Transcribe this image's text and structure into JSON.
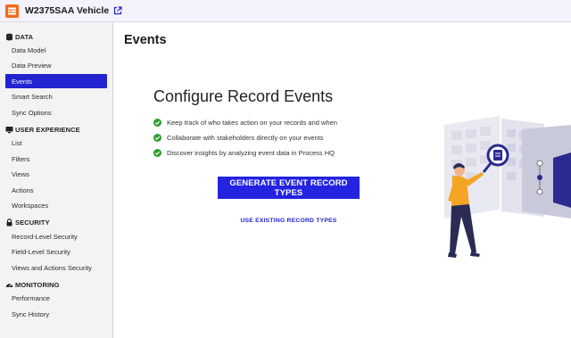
{
  "header": {
    "app_title": "W2375SAA Vehicle",
    "logo_icon": "record-type-icon",
    "open_external_icon": "open-external-icon"
  },
  "sidebar": {
    "sections": [
      {
        "title": "DATA",
        "icon": "database-icon",
        "items": [
          "Data Model",
          "Data Preview",
          "Events",
          "Smart Search",
          "Sync Options"
        ]
      },
      {
        "title": "USER EXPERIENCE",
        "icon": "monitor-icon",
        "items": [
          "List",
          "Filters",
          "Views",
          "Actions",
          "Workspaces"
        ]
      },
      {
        "title": "SECURITY",
        "icon": "lock-icon",
        "items": [
          "Record-Level Security",
          "Field-Level Security",
          "Views and Actions Security"
        ]
      },
      {
        "title": "MONITORING",
        "icon": "gauge-icon",
        "items": [
          "Performance",
          "Sync History"
        ]
      }
    ],
    "active_item": "Events"
  },
  "main": {
    "page_title": "Events",
    "heading": "Configure Record Events",
    "bullets": [
      "Keep track of who takes action on your records and when",
      "Collaborate with stakeholders directly on your events",
      "Discover insights by analyzing event data in Process HQ"
    ],
    "primary_button": "GENERATE EVENT RECORD TYPES",
    "secondary_link": "USE EXISTING RECORD TYPES"
  },
  "colors": {
    "accent": "#2323e0",
    "logo": "#f26a1b",
    "check": "#2e9e2e",
    "sidebar_bg": "#f3f3f3"
  }
}
